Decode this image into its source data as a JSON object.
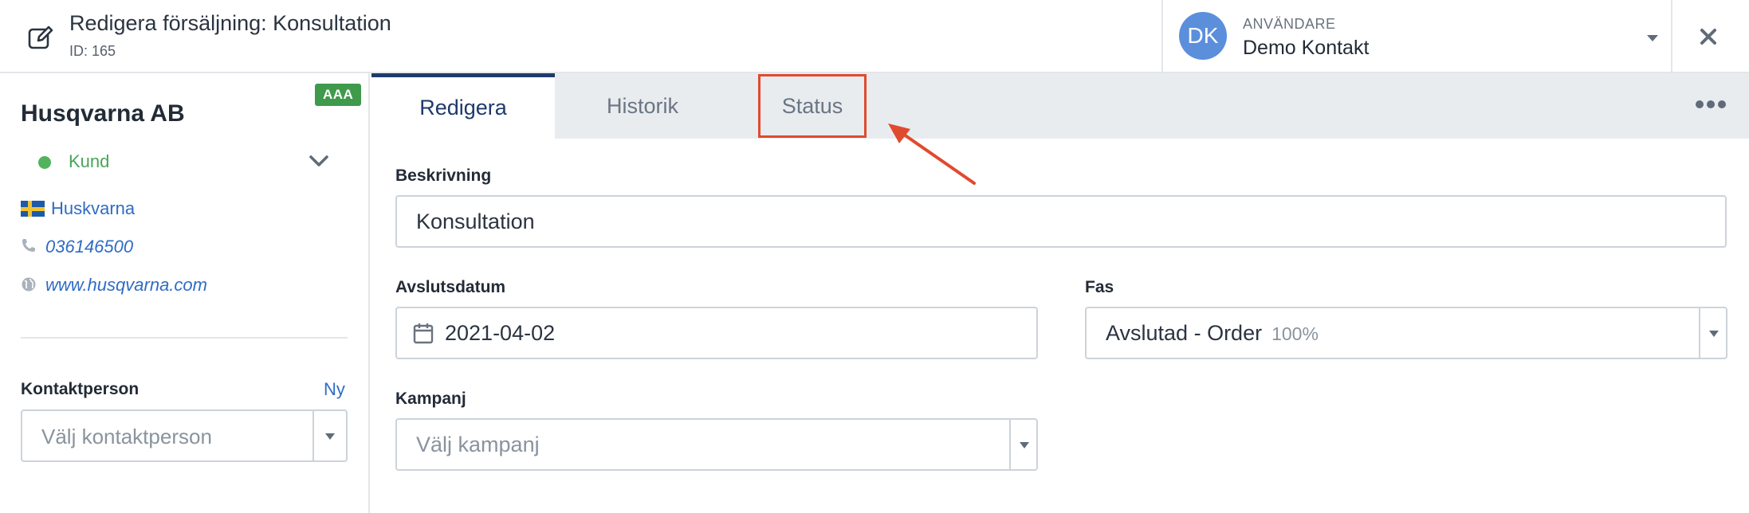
{
  "header": {
    "title": "Redigera försäljning: Konsultation",
    "subtitle": "ID: 165",
    "user": {
      "initials": "DK",
      "role": "ANVÄNDARE",
      "name": "Demo Kontakt",
      "avatar_color": "#5b8fdc"
    },
    "icons": {
      "edit": "edit-icon",
      "close": "close-icon",
      "caret": "chevron-down-icon"
    }
  },
  "sidebar": {
    "badge": "AAA",
    "company": "Husqvarna AB",
    "status": "Kund",
    "city": "Huskvarna",
    "phone": "036146500",
    "website": "www.husqvarna.com",
    "contact_label": "Kontaktperson",
    "contact_new": "Ny",
    "contact_placeholder": "Välj kontaktperson"
  },
  "tabs": [
    {
      "label": "Redigera",
      "active": true
    },
    {
      "label": "Historik",
      "active": false
    },
    {
      "label": "Status",
      "active": false,
      "highlighted": true
    }
  ],
  "form": {
    "description_label": "Beskrivning",
    "description_value": "Konsultation",
    "close_date_label": "Avslutsdatum",
    "close_date_value": "2021-04-02",
    "phase_label": "Fas",
    "phase_value": "Avslutad - Order",
    "phase_percent": "100%",
    "campaign_label": "Kampanj",
    "campaign_placeholder": "Välj kampanj"
  },
  "colors": {
    "accent": "#1d3a6b",
    "link": "#2f6cc4",
    "badge": "#3f9a4b",
    "status": "#52b35f",
    "highlight": "#e04a2f"
  }
}
